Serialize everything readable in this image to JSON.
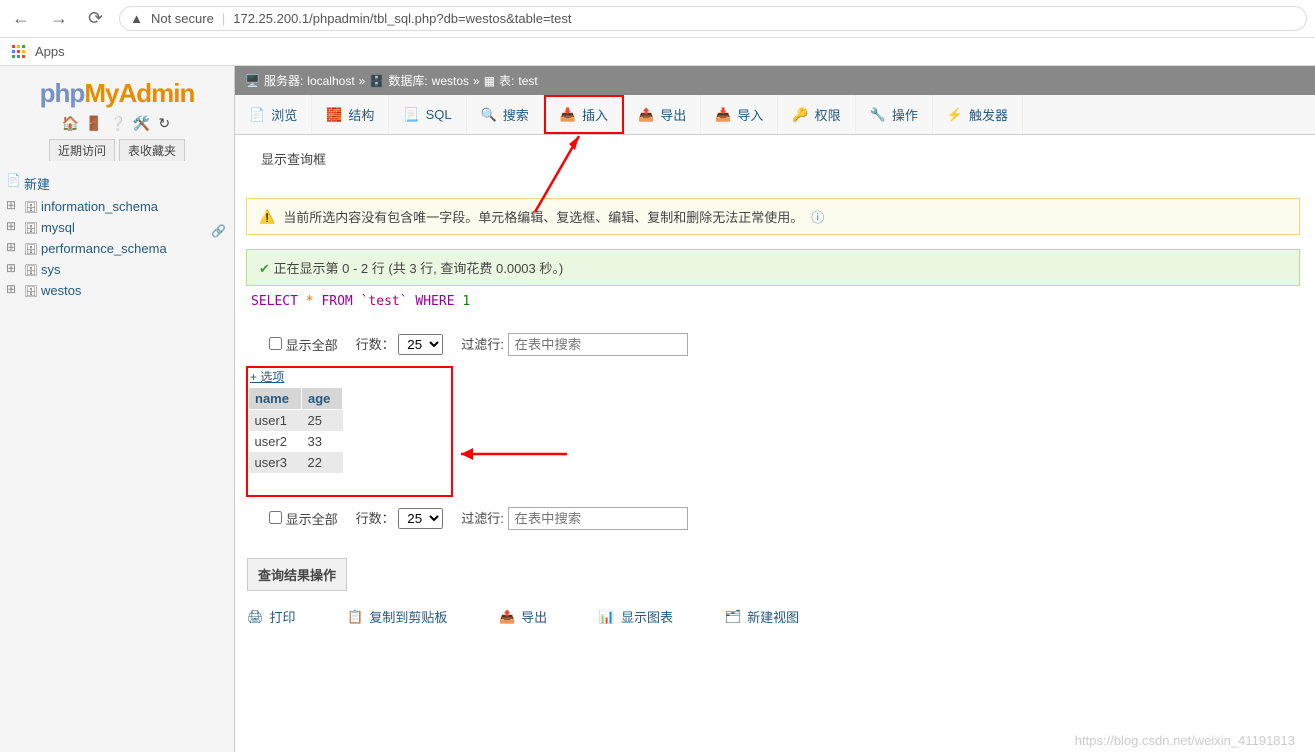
{
  "browser": {
    "not_secure": "Not secure",
    "url": "172.25.200.1/phpadmin/tbl_sql.php?db=westos&table=test",
    "apps": "Apps"
  },
  "logo": {
    "a": "php",
    "b": "MyAdmin"
  },
  "sidenav": {
    "recent": "近期访问",
    "fav": "表收藏夹"
  },
  "tree": {
    "new": "新建",
    "items": [
      "information_schema",
      "mysql",
      "performance_schema",
      "sys",
      "westos"
    ]
  },
  "crumb": {
    "server_l": "服务器:",
    "server_v": "localhost",
    "db_l": "数据库:",
    "db_v": "westos",
    "tbl_l": "表:",
    "tbl_v": "test",
    "sep": "»"
  },
  "tabs": {
    "browse": "浏览",
    "structure": "结构",
    "sql": "SQL",
    "search": "搜索",
    "insert": "插入",
    "export": "导出",
    "import": "导入",
    "priv": "权限",
    "ops": "操作",
    "trig": "触发器"
  },
  "labels": {
    "show_query": "显示查询框",
    "warn": "当前所选内容没有包含唯一字段。单元格编辑、复选框、编辑、复制和删除无法正常使用。",
    "ok": "正在显示第 0 - 2 行 (共 3 行, 查询花费 0.0003 秒。)",
    "show_all": "显示全部",
    "rows": "行数：",
    "rows_opt": "25",
    "filter": "过滤行:",
    "filter_ph": "在表中搜索",
    "options": "+ 选项",
    "col1": "name",
    "col2": "age",
    "results_ops": "查询结果操作",
    "print": "打印",
    "copy": "复制到剪贴板",
    "export": "导出",
    "chart": "显示图表",
    "view": "新建视图"
  },
  "sql": {
    "select": "SELECT",
    "star": "*",
    "from": "FROM",
    "table": "`test`",
    "where": "WHERE",
    "one": "1"
  },
  "rows": [
    {
      "name": "user1",
      "age": "25"
    },
    {
      "name": "user2",
      "age": "33"
    },
    {
      "name": "user3",
      "age": "22"
    }
  ],
  "watermark": "https://blog.csdn.net/weixin_41191813"
}
